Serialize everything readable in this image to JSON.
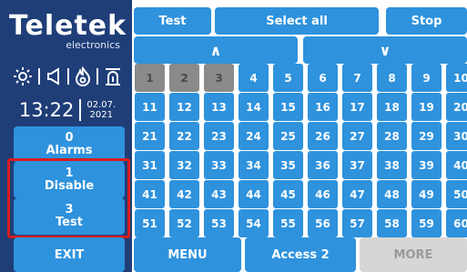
{
  "logo": {
    "brand": "Teletek",
    "sub": "electronics"
  },
  "status_icons": [
    "sun-icon",
    "speaker-icon",
    "flame-icon",
    "siren-icon"
  ],
  "clock": {
    "time": "13:22",
    "date_line1": "02.07.",
    "date_line2": "2021"
  },
  "sidebar": {
    "alarms": {
      "count": "0",
      "label": "Alarms"
    },
    "disable": {
      "count": "1",
      "label": "Disable"
    },
    "test": {
      "count": "3",
      "label": "Test"
    },
    "exit_label": "EXIT"
  },
  "top": {
    "test_label": "Test",
    "select_all_label": "Select all",
    "stop_label": "Stop",
    "up_arrow": "∧",
    "down_arrow": "∨"
  },
  "zones": {
    "inactive": [
      1,
      2,
      3
    ],
    "rows": [
      [
        "1",
        "2",
        "3",
        "4",
        "5",
        "6",
        "7",
        "8",
        "9",
        "10"
      ],
      [
        "11",
        "12",
        "13",
        "14",
        "15",
        "16",
        "17",
        "18",
        "19",
        "20"
      ],
      [
        "21",
        "22",
        "23",
        "24",
        "25",
        "26",
        "27",
        "28",
        "29",
        "30"
      ],
      [
        "31",
        "32",
        "33",
        "34",
        "35",
        "36",
        "37",
        "38",
        "39",
        "40"
      ],
      [
        "41",
        "42",
        "43",
        "44",
        "45",
        "46",
        "47",
        "48",
        "49",
        "50"
      ],
      [
        "51",
        "52",
        "53",
        "54",
        "55",
        "56",
        "57",
        "58",
        "59",
        "60"
      ]
    ]
  },
  "bottom": {
    "menu_label": "MENU",
    "access_label": "Access 2",
    "more_label": "MORE"
  },
  "colors": {
    "sidebar": "#1f3e78",
    "button": "#2e92dd",
    "inactive": "#8a8a8a",
    "highlight": "#d81d1d",
    "disabled": "#d6d6d6"
  }
}
